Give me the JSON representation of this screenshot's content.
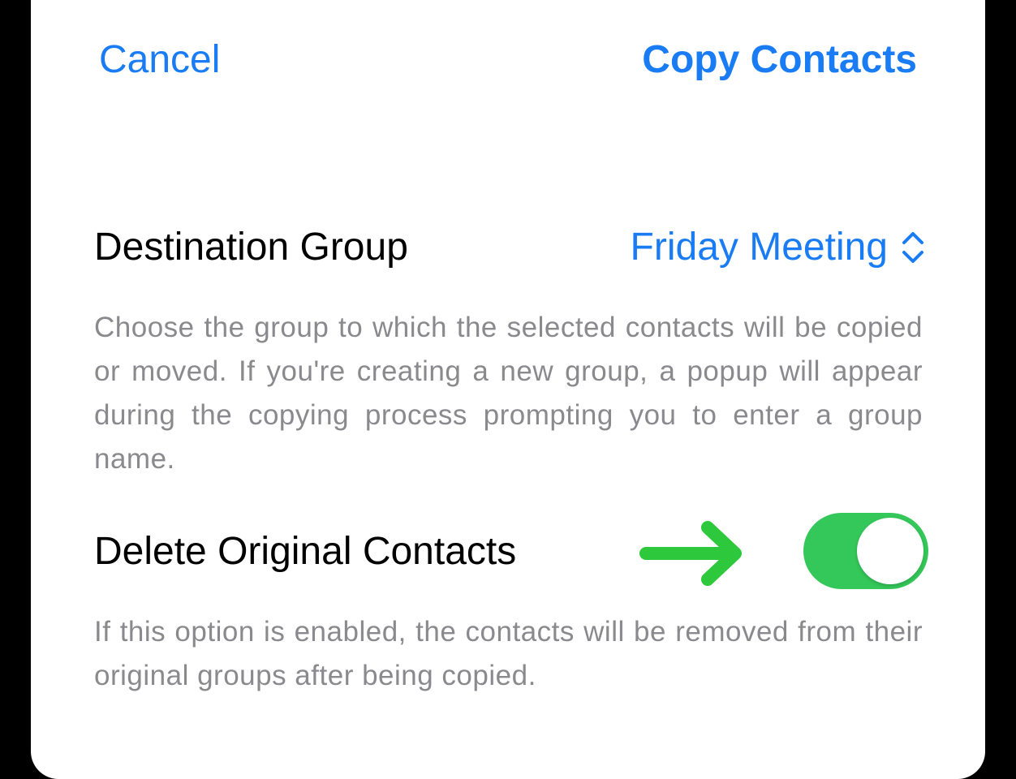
{
  "nav": {
    "cancel_label": "Cancel",
    "confirm_label": "Copy Contacts"
  },
  "destination_group": {
    "label": "Destination Group",
    "selected_value": "Friday Meeting",
    "icon": "chevron-up-down-icon",
    "help_text": "Choose the group to which the selected contacts will be copied or moved. If you're creating a new group, a popup will appear during the copying process prompting you to enter a group name."
  },
  "delete_original": {
    "label": "Delete Original Contacts",
    "enabled": true,
    "help_text": "If this option is enabled, the contacts will be removed from their original groups after being copied."
  },
  "annotation": {
    "icon": "arrow-right-icon",
    "color": "#2dc83c"
  },
  "colors": {
    "accent": "#1a7cf5",
    "toggle_on": "#34c759",
    "secondary_text": "#8a8a8e"
  }
}
